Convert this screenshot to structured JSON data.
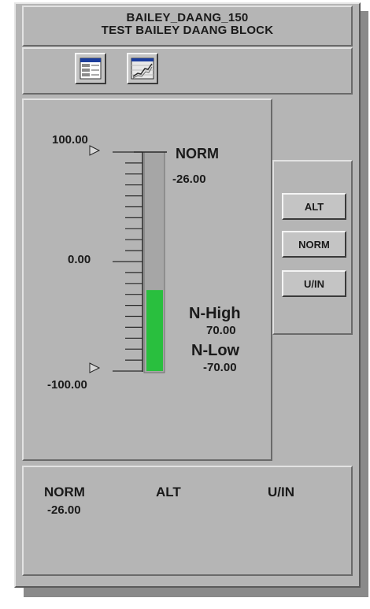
{
  "header": {
    "tag_name": "BAILEY_DAANG_150",
    "description": "TEST BAILEY DAANG BLOCK"
  },
  "toolbar": {
    "buttons": [
      {
        "icon": "faceplate-detail-icon"
      },
      {
        "icon": "trend-icon"
      }
    ]
  },
  "bargraph": {
    "scale_max": "100.00",
    "scale_mid": "0.00",
    "scale_min": "-100.00",
    "range_min": -100,
    "range_max": 100,
    "bar_value": -26,
    "bar_color": "#29bf3e",
    "mode_label": "NORM",
    "mode_value": "-26.00",
    "high_limit_label": "N-High",
    "high_limit_value": "70.00",
    "low_limit_label": "N-Low",
    "low_limit_value": "-70.00"
  },
  "mode_buttons": {
    "alt": "ALT",
    "norm": "NORM",
    "uin": "U/IN"
  },
  "footer": {
    "norm_label": "NORM",
    "norm_value": "-26.00",
    "alt_label": "ALT",
    "uin_label": "U/IN"
  }
}
